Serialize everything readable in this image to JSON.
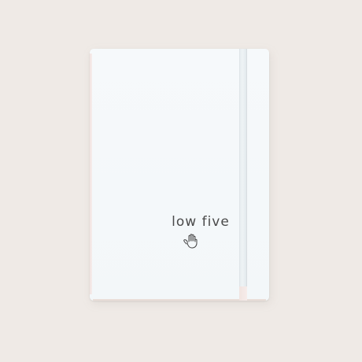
{
  "scene": {
    "background_color": "#efeae6",
    "notebook_color": "#f4f8fa"
  },
  "notebook": {
    "cover_text": "low five",
    "icon": "hand-icon"
  }
}
